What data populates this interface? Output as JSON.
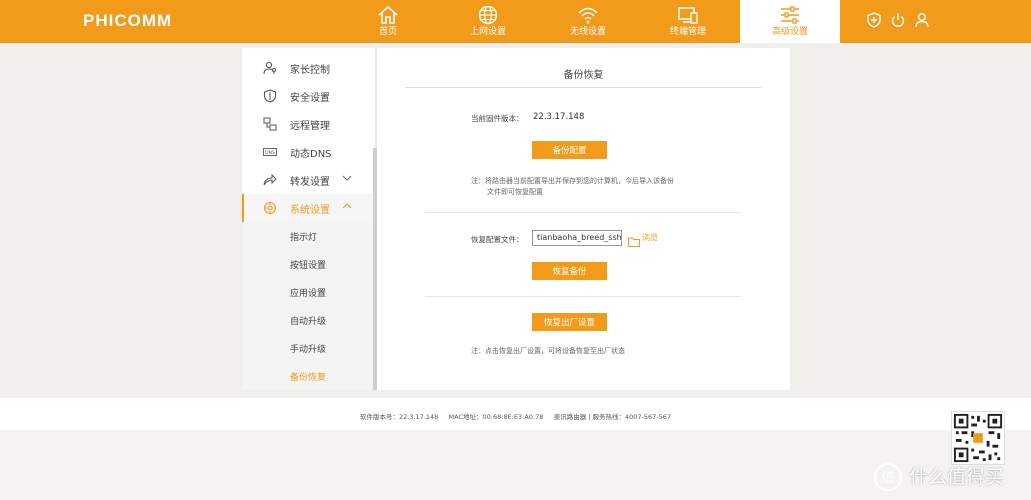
{
  "header": {
    "logo": "PHICOMM",
    "nav": [
      {
        "label": "首页",
        "icon": "home-icon"
      },
      {
        "label": "上网设置",
        "icon": "globe-icon"
      },
      {
        "label": "无线设置",
        "icon": "wifi-icon"
      },
      {
        "label": "终端管理",
        "icon": "devices-icon"
      },
      {
        "label": "高级设置",
        "icon": "sliders-icon"
      }
    ],
    "right_icons": [
      "shield-plus-icon",
      "power-icon",
      "user-icon"
    ],
    "accent": "#f29a1a"
  },
  "sidebar": {
    "items": [
      {
        "label": "家长控制",
        "icon": "parent-icon"
      },
      {
        "label": "安全设置",
        "icon": "shield-icon"
      },
      {
        "label": "远程管理",
        "icon": "remote-icon"
      },
      {
        "label": "动态DNS",
        "icon": "dns-icon",
        "icon_text": "DNS"
      },
      {
        "label": "转发设置",
        "icon": "forward-icon"
      },
      {
        "label": "系统设置",
        "icon": "system-gear-icon"
      }
    ],
    "subitems": [
      "指示灯",
      "按钮设置",
      "应用设置",
      "自动升级",
      "手动升级",
      "备份恢复"
    ]
  },
  "main": {
    "title": "备份恢复",
    "firmware_label": "当前固件版本：",
    "firmware_value": "22.3.17.148",
    "backup_button": "备份配置",
    "backup_note_line1": "注：将路由器当前配置导出并保存到您的计算机，今后导入该备份",
    "backup_note_line2": "文件即可恢复配置",
    "restore_label": "恢复配置文件：",
    "restore_file": "tianbaoha_breed_ssh.dat",
    "browse_label": "浏览",
    "restore_button": "恢复备份",
    "factory_button": "恢复出厂设置",
    "factory_note": "注：点击恢复出厂设置，可将设备恢复至出厂状态"
  },
  "footer": {
    "text": "软件版本号：22.3.17.148     MAC地址：00:68:8E:E3:A0:78     斐讯路由器 | 服务热线：4007-567-567"
  },
  "watermark": {
    "text": "什么值得买",
    "badge": "值"
  }
}
